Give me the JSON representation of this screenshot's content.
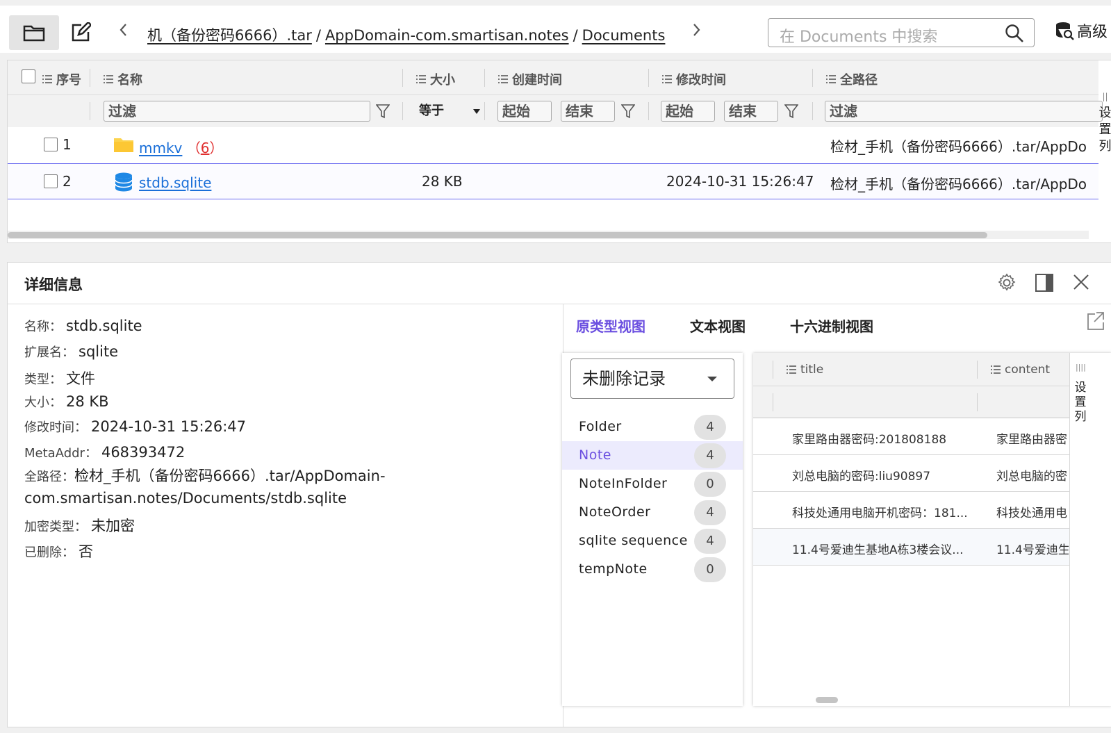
{
  "toolbar": {
    "breadcrumb": [
      "机（备份密码6666）.tar",
      "AppDomain-com.smartisan.notes",
      "Documents"
    ],
    "back_icon": "chevron-left-icon",
    "forward_icon": "chevron-right-icon",
    "search_placeholder": "在 Documents 中搜索",
    "advanced_label": "高级"
  },
  "file_table": {
    "columns": {
      "index": "序号",
      "name": "名称",
      "size": "大小",
      "created": "创建时间",
      "modified": "修改时间",
      "full_path": "全路径"
    },
    "filters": {
      "name": "过滤",
      "size_op": "等于",
      "created_start": "起始",
      "created_end": "结束",
      "modified_start": "起始",
      "modified_end": "结束",
      "full_path": "过滤"
    },
    "rows": [
      {
        "index": "1",
        "name": "mmkv",
        "count_open": "（",
        "count": "6",
        "count_close": "）",
        "size": "",
        "created": "",
        "modified": "",
        "path": "检材_手机（备份密码6666）.tar/AppDo"
      },
      {
        "index": "2",
        "name": "stdb.sqlite",
        "size": "28 KB",
        "created": "",
        "modified": "2024-10-31 15:26:47",
        "path": "检材_手机（备份密码6666）.tar/AppDo"
      }
    ],
    "side_setting": "设置列"
  },
  "details": {
    "title": "详细信息",
    "fields": {
      "name_label": "名称：",
      "name": "stdb.sqlite",
      "ext_label": "扩展名：",
      "ext": "sqlite",
      "type_label": "类型：",
      "type": "文件",
      "size_label": "大小：",
      "size": "28 KB",
      "mtime_label": "修改时间：",
      "mtime": "2024-10-31 15:26:47",
      "meta_label": "MetaAddr：",
      "meta": "468393472",
      "path_label": "全路径：",
      "path": "检材_手机（备份密码6666）.tar/AppDomain-com.smartisan.notes/Documents/stdb.sqlite",
      "enc_label": "加密类型：",
      "enc": "未加密",
      "del_label": "已删除：",
      "del": "否"
    },
    "views": {
      "native": "原类型视图",
      "text": "文本视图",
      "hex": "十六进制视图"
    },
    "record_filter": "未删除记录",
    "tables": [
      {
        "name": "Folder",
        "count": "4"
      },
      {
        "name": "Note",
        "count": "4"
      },
      {
        "name": "NoteInFolder",
        "count": "0"
      },
      {
        "name": "NoteOrder",
        "count": "4"
      },
      {
        "name": "sqlite sequence",
        "count": "4"
      },
      {
        "name": "tempNote",
        "count": "0"
      }
    ],
    "grid": {
      "col_title": "title",
      "col_content": "content",
      "rows": [
        {
          "title": "家里路由器密码:201808188",
          "content": "家里路由器密"
        },
        {
          "title": "刘总电脑的密码:liu90897",
          "content": "刘总电脑的密"
        },
        {
          "title": "科技处通用电脑开机密码：181...",
          "content": "科技处通用电"
        },
        {
          "title": "11.4号爱迪生基地A栋3楼会议...",
          "content": "11.4号爱迪生"
        }
      ],
      "side_setting": "设置列"
    }
  },
  "colors": {
    "accent": "#6b4fe0",
    "link": "#1a6fd8",
    "count": "#e03030",
    "selection_border": "#6a6af0"
  }
}
